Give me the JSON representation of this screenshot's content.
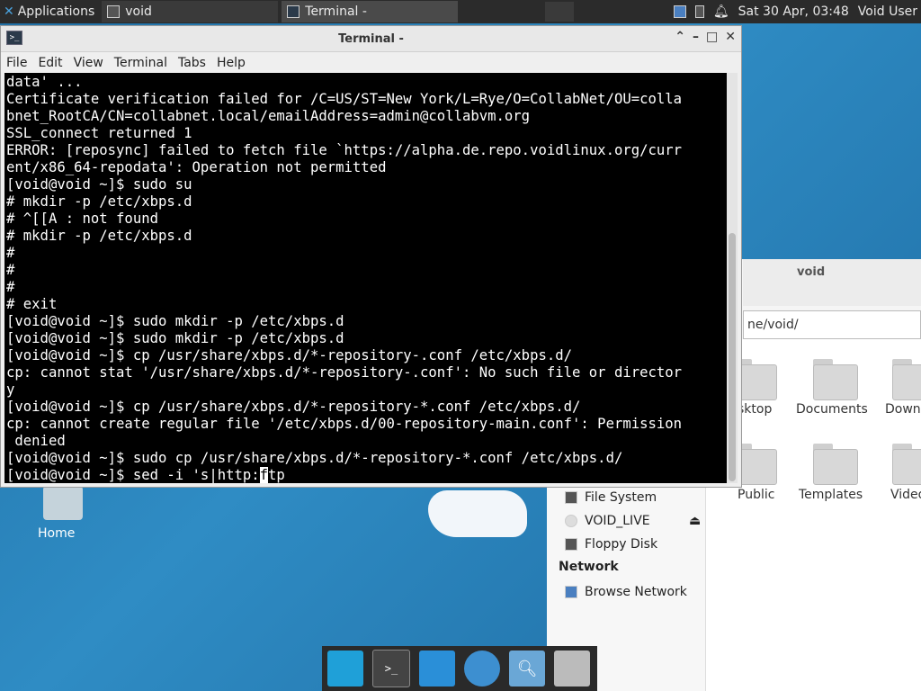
{
  "panel": {
    "applications_label": "Applications",
    "task1_label": "void",
    "task2_label": "Terminal -",
    "clock": "Sat 30 Apr, 03:48",
    "user": "Void User"
  },
  "terminal": {
    "title": "Terminal -",
    "menu": [
      "File",
      "Edit",
      "View",
      "Terminal",
      "Tabs",
      "Help"
    ],
    "lines": [
      "data' ...",
      "Certificate verification failed for /C=US/ST=New York/L=Rye/O=CollabNet/OU=colla",
      "bnet_RootCA/CN=collabnet.local/emailAddress=admin@collabvm.org",
      "SSL_connect returned 1",
      "ERROR: [reposync] failed to fetch file `https://alpha.de.repo.voidlinux.org/curr",
      "ent/x86_64-repodata': Operation not permitted",
      "[void@void ~]$ sudo su",
      "# mkdir -p /etc/xbps.d",
      "# ^[[A : not found",
      "# mkdir -p /etc/xbps.d",
      "#",
      "#",
      "#",
      "# exit",
      "[void@void ~]$ sudo mkdir -p /etc/xbps.d",
      "[void@void ~]$ sudo mkdir -p /etc/xbps.d",
      "[void@void ~]$ cp /usr/share/xbps.d/*-repository-.conf /etc/xbps.d/",
      "cp: cannot stat '/usr/share/xbps.d/*-repository-.conf': No such file or director",
      "y",
      "[void@void ~]$ cp /usr/share/xbps.d/*-repository-*.conf /etc/xbps.d/",
      "cp: cannot create regular file '/etc/xbps.d/00-repository-main.conf': Permission",
      " denied",
      "[void@void ~]$ sudo cp /usr/share/xbps.d/*-repository-*.conf /etc/xbps.d/"
    ],
    "prompt_before_cursor": "[void@void ~]$ sed -i 's|http:",
    "cursor_char": "f",
    "prompt_after_cursor": "tp"
  },
  "file_manager": {
    "title": "void",
    "path": "ne/void/",
    "folders": [
      "sktop",
      "Documents",
      "Downlo",
      "Public",
      "Templates",
      "Video"
    ],
    "places": [
      "File System",
      "VOID_LIVE",
      "Floppy Disk"
    ],
    "network_header": "Network",
    "network_items": [
      "Browse Network"
    ]
  },
  "desktop": {
    "home_label": "Home"
  }
}
